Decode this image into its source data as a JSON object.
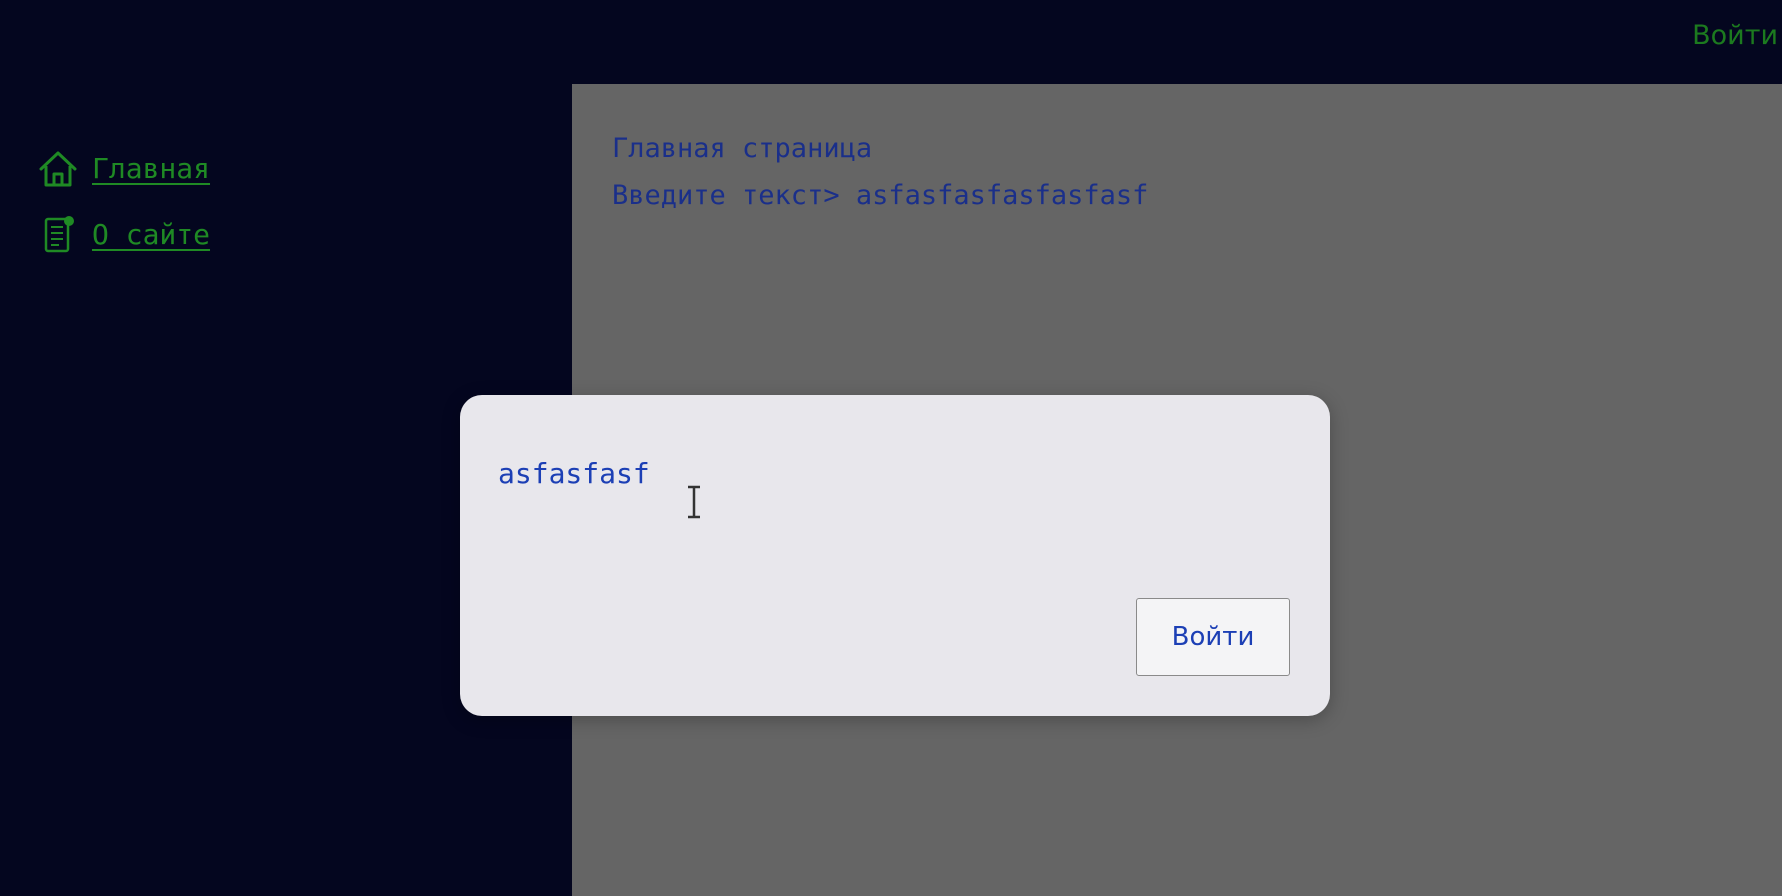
{
  "header": {
    "login_label": "Войти"
  },
  "sidebar": {
    "items": [
      {
        "label": "Главная",
        "icon": "home-icon"
      },
      {
        "label": "О сайте",
        "icon": "document-icon"
      }
    ]
  },
  "main": {
    "title": "Главная страница",
    "prompt_line": "Введите текст> asfasfasfasfasfasf"
  },
  "modal": {
    "input_value": "asfasfasf",
    "submit_label": "Войти"
  },
  "colors": {
    "background": "#04061f",
    "nav_link": "#1f8a24",
    "main_bg": "#656565",
    "main_text": "#1a2f8a",
    "modal_bg": "#e8e7ec",
    "modal_text": "#1c3fb5"
  }
}
